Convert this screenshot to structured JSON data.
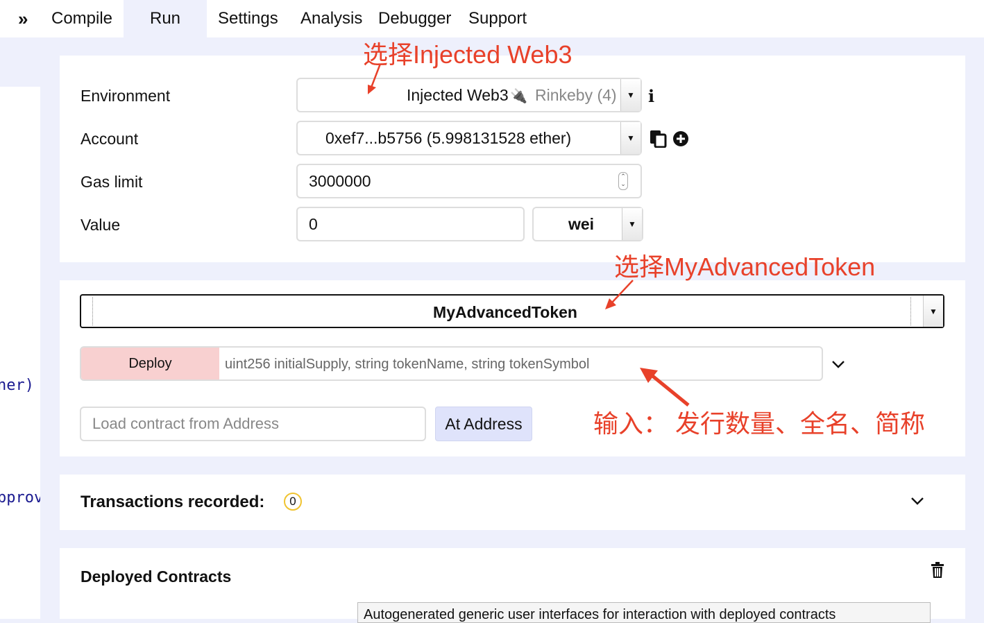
{
  "tabs": {
    "expand_icon": "double-chevron-right",
    "items": [
      {
        "label": "Compile"
      },
      {
        "label": "Run"
      },
      {
        "label": "Settings"
      },
      {
        "label": "Analysis"
      },
      {
        "label": "Debugger"
      },
      {
        "label": "Support"
      }
    ],
    "active": "Run"
  },
  "code_fragments": [
    "ner)",
    "pprov"
  ],
  "environment": {
    "label": "Environment",
    "value": "Injected Web3",
    "network": "Rinkeby (4)",
    "info_icon": "info-icon"
  },
  "account": {
    "label": "Account",
    "value": "0xef7...b5756 (5.998131528 ether)"
  },
  "gas_limit": {
    "label": "Gas limit",
    "value": "3000000"
  },
  "value_field": {
    "label": "Value",
    "value": "0",
    "unit": "wei"
  },
  "contract": {
    "selected": "MyAdvancedToken"
  },
  "deploy": {
    "button_label": "Deploy",
    "params_placeholder": "uint256 initialSupply, string tokenName, string tokenSymbol"
  },
  "at_address": {
    "placeholder": "Load contract from Address",
    "button_label": "At Address"
  },
  "transactions": {
    "label": "Transactions recorded:",
    "count": "0"
  },
  "deployed": {
    "title": "Deployed Contracts",
    "tooltip": "Autogenerated generic user interfaces for interaction with deployed contracts"
  },
  "annotations": {
    "select_web3": "选择Injected Web3",
    "select_token": "选择MyAdvancedToken",
    "input_hint": "输入： 发行数量、全名、简称"
  },
  "colors": {
    "annotation": "#e8412a",
    "deploy_button": "#f8d0d0",
    "at_address_button": "#dfe3fb",
    "badge": "#f0c330"
  }
}
